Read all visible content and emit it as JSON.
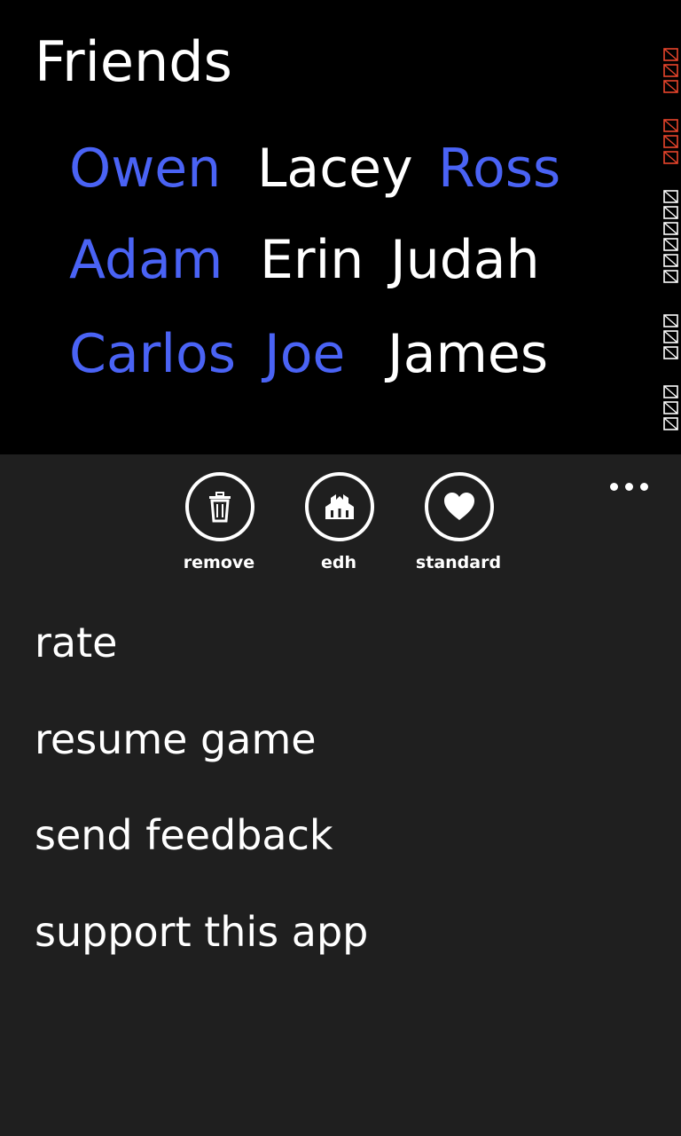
{
  "page": {
    "title": "Friends"
  },
  "friends": {
    "rows": [
      [
        {
          "name": "Owen",
          "state": "active"
        },
        {
          "name": "Lacey",
          "state": "inactive"
        },
        {
          "name": "Ross",
          "state": "active"
        }
      ],
      [
        {
          "name": "Adam",
          "state": "active"
        },
        {
          "name": "Erin",
          "state": "inactive"
        },
        {
          "name": "Judah",
          "state": "inactive"
        }
      ],
      [
        {
          "name": "Carlos",
          "state": "active"
        },
        {
          "name": "Joe",
          "state": "active"
        },
        {
          "name": "James",
          "state": "inactive"
        }
      ]
    ]
  },
  "colors": {
    "active_name": "#4a63f5",
    "inactive_name": "#ffffff",
    "app_bar_background": "#1f1f1f",
    "debug_red": "#e8452c"
  },
  "app_bar": {
    "more_icon": "ellipsis-icon",
    "buttons": [
      {
        "label": "remove",
        "icon": "trash-icon"
      },
      {
        "label": "edh",
        "icon": "castle-icon"
      },
      {
        "label": "standard",
        "icon": "heart-icon"
      }
    ],
    "menu_items": [
      {
        "label": "rate"
      },
      {
        "label": "resume game"
      },
      {
        "label": "send feedback"
      },
      {
        "label": "support this app"
      }
    ]
  }
}
